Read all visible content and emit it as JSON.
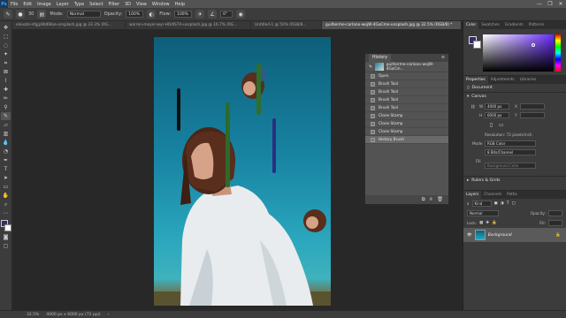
{
  "menubar": {
    "logo": "Ps",
    "items": [
      "File",
      "Edit",
      "Image",
      "Layer",
      "Type",
      "Select",
      "Filter",
      "3D",
      "View",
      "Window",
      "Help"
    ],
    "window_controls": [
      "—",
      "❐",
      "✕"
    ]
  },
  "options": {
    "brush_size": "30",
    "mode_label": "Mode:",
    "mode_value": "Normal",
    "opacity_label": "Opacity:",
    "opacity_value": "100%",
    "flow_label": "Flow:",
    "flow_value": "100%",
    "angle_value": "0°"
  },
  "tabs": [
    {
      "label": "elevate-nfgjy9bl69oe-unsplash.jpg @ 33.3% (RG...",
      "active": false
    },
    {
      "label": "warren-meyer-wyr-HOdlS7A-unsplash.jpg @ 16.7% (RG...",
      "active": false
    },
    {
      "label": "Untitled-1 @ 50% (RGB/8...",
      "active": false
    },
    {
      "label": "guilherme-carlano-wojW-4GaCme-unsplash.jpg @ 32.5% (RGB/8) *",
      "active": true
    }
  ],
  "history": {
    "tab_label": "History",
    "snapshot_label": "guilherme-carlano-wojW-4GaCm...",
    "steps": [
      "Open",
      "Brush Tool",
      "Brush Tool",
      "Brush Tool",
      "Brush Tool",
      "Clone Stamp",
      "Clone Stamp",
      "Clone Stamp",
      "History Brush"
    ],
    "selected_step_index": 8
  },
  "color_panel": {
    "tabs": [
      "Color",
      "Swatches",
      "Gradients",
      "Patterns"
    ],
    "foreground": "#3a2a6a",
    "background": "#ffffff"
  },
  "properties": {
    "tabs": [
      "Properties",
      "Adjustments",
      "Libraries"
    ],
    "doc_label": "Document",
    "canvas_label": "Canvas",
    "w_label": "W",
    "w_value": "4000 px",
    "h_label": "H",
    "h_value": "6000 px",
    "x_label": "X",
    "y_label": "Y",
    "resolution": "Resolution: 72 pixels/inch",
    "mode_label": "Mode",
    "mode_value": "RGB Color",
    "depth_value": "8 Bits/Channel",
    "fill_label": "Fill",
    "fill_value": "Background Color",
    "rulers_label": "Rulers & Grids"
  },
  "layers": {
    "tabs": [
      "Layers",
      "Channels",
      "Paths"
    ],
    "kind_label": "Kind",
    "blend_value": "Normal",
    "opacity_label": "Opacity:",
    "lock_label": "Lock:",
    "fill_label": "Fill:",
    "layer_name": "Background"
  },
  "status": {
    "zoom": "32.5%",
    "doc_size": "4000 px x 6000 px (72 ppi)"
  }
}
